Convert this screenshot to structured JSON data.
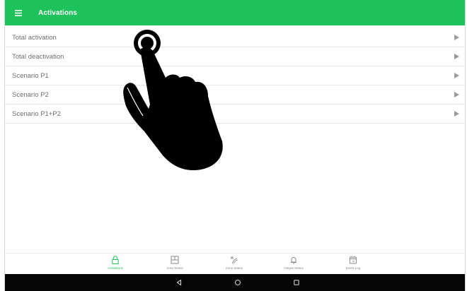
{
  "header": {
    "title": "Activations",
    "menu_icon": "hamburger-menu-icon",
    "background_color": "#1ec25a"
  },
  "activations": {
    "items": [
      {
        "label": "Total activation"
      },
      {
        "label": "Total deactivation"
      },
      {
        "label": "Scenario P1"
      },
      {
        "label": "Scenario P2"
      },
      {
        "label": "Scenario P1+P2"
      }
    ]
  },
  "bottom_nav": {
    "accent_color": "#1ec25a",
    "items": [
      {
        "label": "Activations",
        "icon": "padlock-icon",
        "active": true
      },
      {
        "label": "Area Status",
        "icon": "area-grid-icon",
        "active": false
      },
      {
        "label": "Zone Status",
        "icon": "zone-status-icon",
        "active": false
      },
      {
        "label": "Output Status",
        "icon": "bell-icon",
        "active": false
      },
      {
        "label": "Event Log",
        "icon": "calendar-icon",
        "active": false
      }
    ]
  },
  "system_nav": {
    "buttons": [
      "back-icon",
      "home-icon",
      "recents-icon"
    ]
  }
}
